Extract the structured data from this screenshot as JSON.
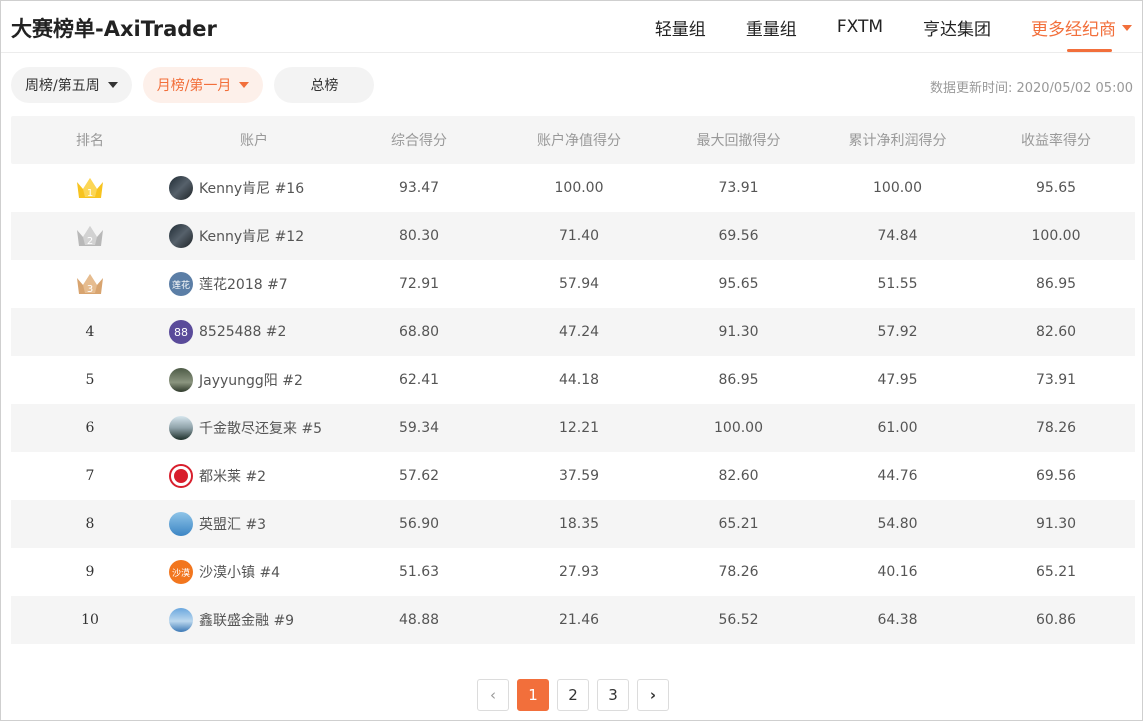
{
  "header": {
    "title": "大赛榜单-AxiTrader",
    "nav": [
      "轻量组",
      "重量组",
      "FXTM",
      "亨达集团"
    ],
    "more_label": "更多经纪商",
    "accent": "#f26f3b"
  },
  "filters": {
    "weekly": "周榜/第五周",
    "monthly": "月榜/第一月",
    "total": "总榜"
  },
  "update_time": "数据更新时间: 2020/05/02 05:00",
  "table": {
    "columns": [
      "排名",
      "账户",
      "综合得分",
      "账户净值得分",
      "最大回撤得分",
      "累计净利润得分",
      "收益率得分"
    ],
    "rows": [
      {
        "rank": "1",
        "crown": "gold-crown-icon",
        "avatar": "kenny",
        "avatar_text": "",
        "account": "Kenny肯尼 #16",
        "score": "93.47",
        "equity": "100.00",
        "drawdown": "73.91",
        "profit": "100.00",
        "yield": "95.65"
      },
      {
        "rank": "2",
        "crown": "silver-crown-icon",
        "avatar": "kenny",
        "avatar_text": "",
        "account": "Kenny肯尼 #12",
        "score": "80.30",
        "equity": "71.40",
        "drawdown": "69.56",
        "profit": "74.84",
        "yield": "100.00"
      },
      {
        "rank": "3",
        "crown": "bronze-crown-icon",
        "avatar": "lotus",
        "avatar_text": "莲花",
        "account": "莲花2018 #7",
        "score": "72.91",
        "equity": "57.94",
        "drawdown": "95.65",
        "profit": "51.55",
        "yield": "86.95"
      },
      {
        "rank": "4",
        "crown": "",
        "avatar": "88",
        "avatar_text": "88",
        "account": "8525488 #2",
        "score": "68.80",
        "equity": "47.24",
        "drawdown": "91.30",
        "profit": "57.92",
        "yield": "82.60"
      },
      {
        "rank": "5",
        "crown": "",
        "avatar": "jay",
        "avatar_text": "",
        "account": "Jayyungg阳 #2",
        "score": "62.41",
        "equity": "44.18",
        "drawdown": "86.95",
        "profit": "47.95",
        "yield": "73.91"
      },
      {
        "rank": "6",
        "crown": "",
        "avatar": "qian",
        "avatar_text": "",
        "account": "千金散尽还复来 #5",
        "score": "59.34",
        "equity": "12.21",
        "drawdown": "100.00",
        "profit": "61.00",
        "yield": "78.26"
      },
      {
        "rank": "7",
        "crown": "",
        "avatar": "dumi",
        "avatar_text": "",
        "account": "都米莱 #2",
        "score": "57.62",
        "equity": "37.59",
        "drawdown": "82.60",
        "profit": "44.76",
        "yield": "69.56"
      },
      {
        "rank": "8",
        "crown": "",
        "avatar": "ying",
        "avatar_text": "",
        "account": "英盟汇 #3",
        "score": "56.90",
        "equity": "18.35",
        "drawdown": "65.21",
        "profit": "54.80",
        "yield": "91.30"
      },
      {
        "rank": "9",
        "crown": "",
        "avatar": "sha",
        "avatar_text": "沙漠",
        "account": "沙漠小镇 #4",
        "score": "51.63",
        "equity": "27.93",
        "drawdown": "78.26",
        "profit": "40.16",
        "yield": "65.21"
      },
      {
        "rank": "10",
        "crown": "",
        "avatar": "xin",
        "avatar_text": "",
        "account": "鑫联盛金融 #9",
        "score": "48.88",
        "equity": "21.46",
        "drawdown": "56.52",
        "profit": "64.38",
        "yield": "60.86"
      }
    ]
  },
  "pagination": {
    "pages": [
      "1",
      "2",
      "3"
    ],
    "current": "1",
    "prev_icon": "chevron-left-icon",
    "next_icon": "chevron-right-icon"
  }
}
